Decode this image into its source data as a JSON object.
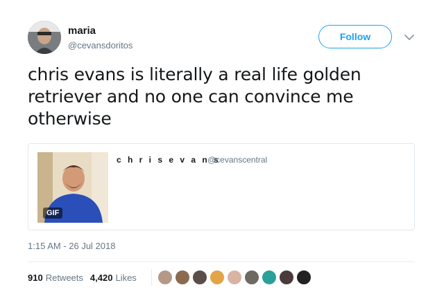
{
  "user": {
    "display_name": "maria",
    "handle": "@cevansdoritos"
  },
  "actions": {
    "follow_label": "Follow",
    "more_icon": "chevron-down-icon"
  },
  "tweet": {
    "lines": [
      "chris evans is literally a real life golden",
      "retriever and no one can convince me",
      "otherwise"
    ]
  },
  "quote": {
    "name": "c h r i s e v a n s",
    "handle": "@cevanscentral",
    "media_badge": "GIF"
  },
  "timestamp": "1:15 AM - 26 Jul 2018",
  "stats": {
    "retweets_count": "910",
    "retweets_label": "Retweets",
    "likes_count": "4,420",
    "likes_label": "Likes"
  },
  "colors": {
    "accent": "#1da1f2",
    "text": "#14171a",
    "muted": "#657786",
    "border": "#e1e8ed"
  },
  "likers": [
    {
      "name": "liker-1",
      "color": "#b49a86"
    },
    {
      "name": "liker-2",
      "color": "#8c6a4f"
    },
    {
      "name": "liker-3",
      "color": "#5b4d48"
    },
    {
      "name": "liker-4",
      "color": "#e2a447"
    },
    {
      "name": "liker-5",
      "color": "#d9b3a3"
    },
    {
      "name": "liker-6",
      "color": "#6d6a62"
    },
    {
      "name": "liker-7",
      "color": "#2aa198"
    },
    {
      "name": "liker-8",
      "color": "#4a3a3a"
    },
    {
      "name": "liker-9",
      "color": "#222222"
    }
  ]
}
